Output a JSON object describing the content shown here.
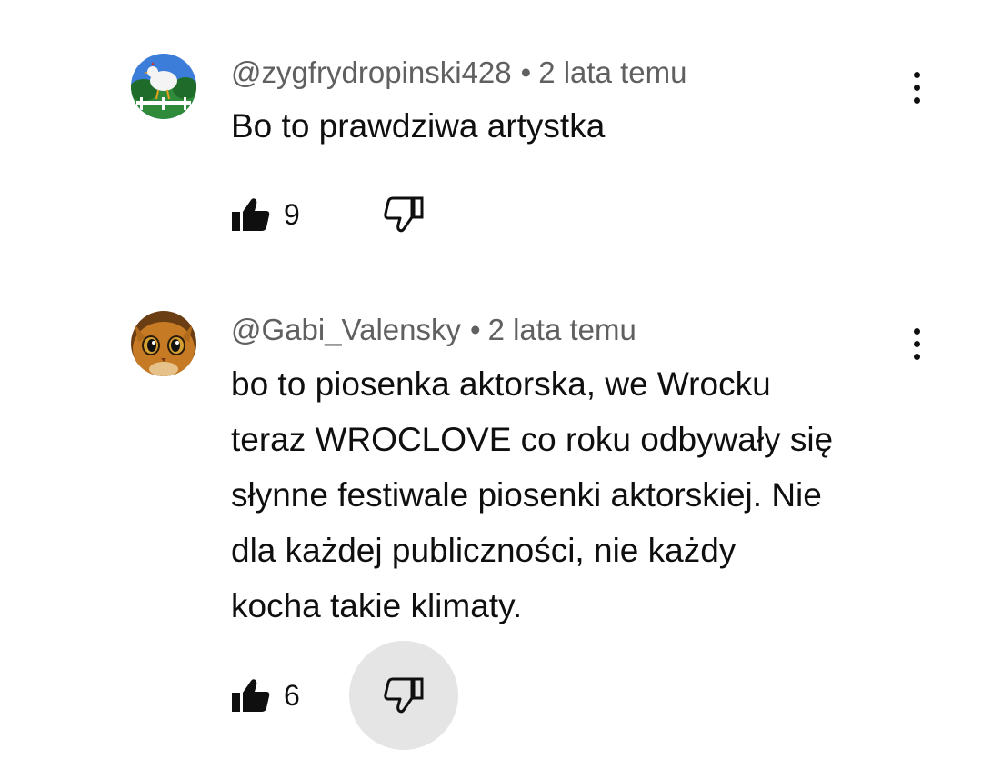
{
  "comments": [
    {
      "author": "@zygfrydropinski428",
      "time": "2 lata temu",
      "separator": "•",
      "text_lines": [
        "Bo to prawdziwa artystka"
      ],
      "likes": "9",
      "dislike_pressed": false,
      "avatar_icon": "chicken-avatar"
    },
    {
      "author": "@Gabi_Valensky",
      "time": "2 lata temu",
      "separator": "•",
      "text_lines": [
        "bo to piosenka aktorska, we Wrocku",
        "teraz WROCLOVE co roku odbywały się",
        "słynne festiwale piosenki aktorskiej. Nie",
        "dla każdej publiczności, nie każdy",
        "kocha takie klimaty."
      ],
      "likes": "6",
      "dislike_pressed": true,
      "avatar_icon": "cat-avatar"
    }
  ],
  "colors": {
    "text_primary": "#0f0f0f",
    "text_secondary": "#606060",
    "pressed_bg": "#e5e5e5",
    "background": "#ffffff"
  }
}
